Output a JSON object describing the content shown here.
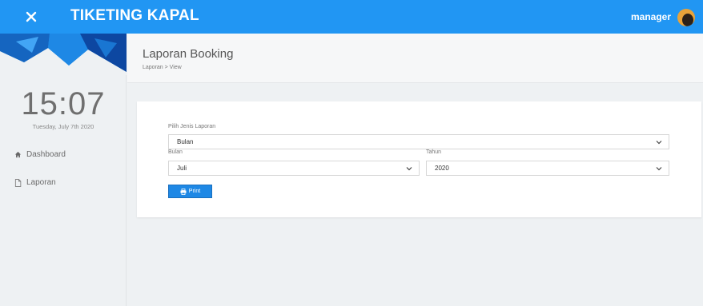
{
  "header": {
    "brand": "TIKETING KAPAL",
    "user_name": "manager"
  },
  "colors": {
    "topbar": "#2196f3",
    "button": "#1e88e5"
  },
  "sidebar": {
    "clock": "15:07",
    "date": "Tuesday, July 7th 2020",
    "items": [
      {
        "label": "Dashboard",
        "icon": "home-icon"
      },
      {
        "label": "Laporan",
        "icon": "file-icon"
      }
    ]
  },
  "page": {
    "title": "Laporan Booking",
    "breadcrumb": "Laporan > View"
  },
  "form": {
    "report_type_label": "Pilih Jenis Laporan",
    "report_type_value": "Bulan",
    "month_label": "Bulan",
    "month_value": "Juli",
    "year_label": "Tahun",
    "year_value": "2020",
    "print_label": "Print"
  }
}
